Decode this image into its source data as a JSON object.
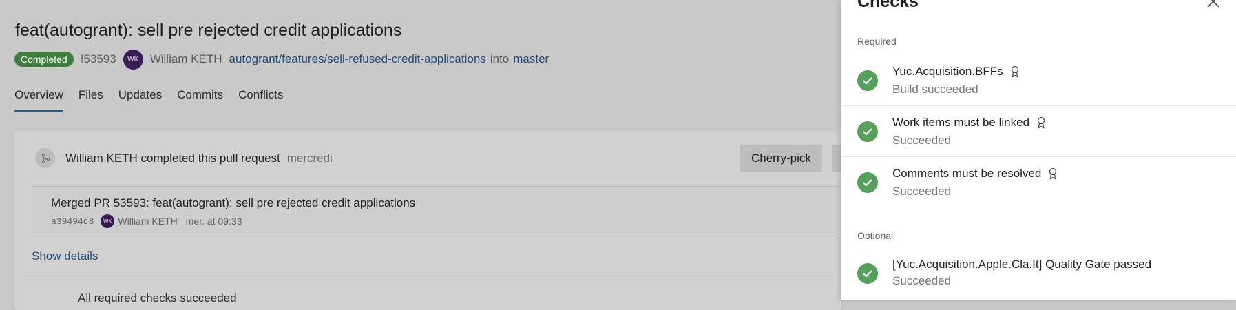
{
  "pr": {
    "title": "feat(autogrant): sell pre rejected credit applications",
    "status_badge": "Completed",
    "id": "!53593",
    "author_initials": "WK",
    "author": "William KETH",
    "source_branch": "autogrant/features/sell-refused-credit-applications",
    "into_text": "into",
    "target_branch": "master"
  },
  "tabs": [
    {
      "label": "Overview"
    },
    {
      "label": "Files"
    },
    {
      "label": "Updates"
    },
    {
      "label": "Commits"
    },
    {
      "label": "Conflicts"
    }
  ],
  "overview": {
    "completed_text": "William KETH completed this pull request",
    "completed_date": "mercredi",
    "cherry_pick_label": "Cherry-pick",
    "merge_commit": {
      "title": "Merged PR 53593: feat(autogrant): sell pre rejected credit applications",
      "hash": "a39494c8",
      "author_initials": "WK",
      "author": "William KETH",
      "time": "mer. at 09:33"
    },
    "show_details_label": "Show details",
    "truncated_row": "All required checks succeeded"
  },
  "panel": {
    "title": "Checks",
    "required_label": "Required",
    "optional_label": "Optional",
    "required_checks": [
      {
        "name": "Yuc.Acquisition.BFFs",
        "status": "Build succeeded"
      },
      {
        "name": "Work items must be linked",
        "status": "Succeeded"
      },
      {
        "name": "Comments must be resolved",
        "status": "Succeeded"
      }
    ],
    "optional_checks": [
      {
        "name": "[Yuc.Acquisition.Apple.Cla.It] Quality Gate passed",
        "status": "Succeeded"
      }
    ]
  },
  "colors": {
    "success": "#55a05a",
    "badge_completed": "#3d7d3d",
    "link": "#1f4e7a",
    "avatar": "#3a1b54"
  },
  "icons": {
    "check": "check-icon",
    "required_policy": "ribbon-icon",
    "close": "close-icon",
    "merge": "merge-icon"
  }
}
